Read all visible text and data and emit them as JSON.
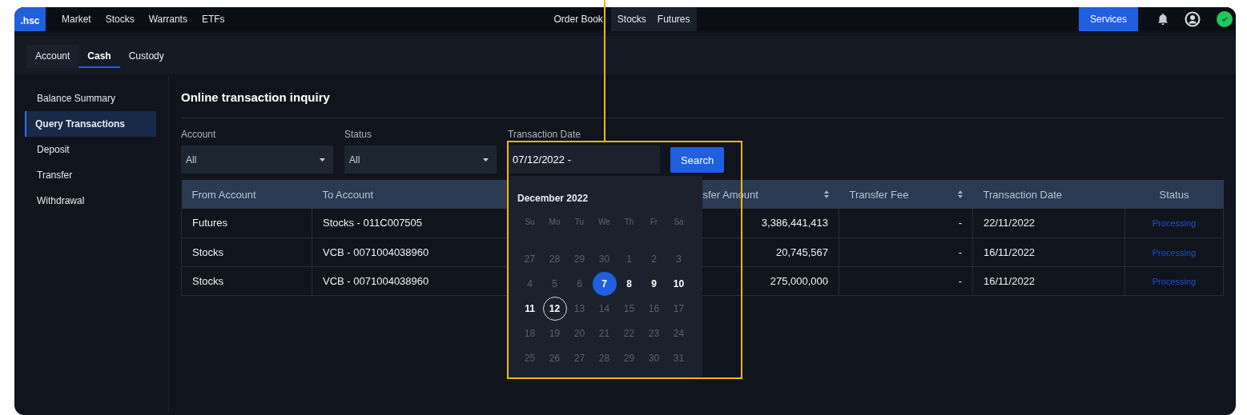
{
  "topbar": {
    "logo": ".hsc",
    "nav": [
      {
        "label": "Market"
      },
      {
        "label": "Stocks"
      },
      {
        "label": "Warrants"
      },
      {
        "label": "ETFs"
      }
    ],
    "order_book": {
      "label": "Order Book",
      "expanded": true,
      "tabs": [
        {
          "label": "Stocks"
        },
        {
          "label": "Futures"
        }
      ]
    },
    "services_button": "Services",
    "connected": true
  },
  "tabs": [
    {
      "label": "Account",
      "selected": false
    },
    {
      "label": "Cash",
      "selected": true
    },
    {
      "label": "Custody",
      "selected": false
    }
  ],
  "sidebar": {
    "items": [
      {
        "label": "Balance Summary",
        "selected": false
      },
      {
        "label": "Query Transactions",
        "selected": true
      },
      {
        "label": "Deposit",
        "selected": false
      },
      {
        "label": "Transfer",
        "selected": false
      },
      {
        "label": "Withdrawal",
        "selected": false
      }
    ]
  },
  "page": {
    "title": "Online transaction inquiry",
    "filters": [
      {
        "kind": "select",
        "label": "Account",
        "value": "All"
      },
      {
        "kind": "select",
        "label": "Status",
        "value": "All"
      },
      {
        "kind": "date",
        "label": "Transaction Date",
        "value": "07/12/2022 -"
      }
    ],
    "search_button": "Search"
  },
  "table": {
    "columns": [
      {
        "label": "From Account",
        "kind": "text",
        "sortable": false
      },
      {
        "label": "To Account",
        "kind": "text"
      },
      {
        "label": "sfer Amount",
        "kind": "number",
        "sortable": true
      },
      {
        "label": "Transfer Fee",
        "kind": "number",
        "sortable": true
      },
      {
        "label": "Transaction Date",
        "kind": "text",
        "sortable": false
      },
      {
        "label": "Status",
        "kind": "status",
        "sortable": false
      }
    ],
    "rows": [
      {
        "cells": [
          "Futures",
          "Stocks - 011C007505",
          "3,386,441,413",
          "-",
          "22/11/2022",
          "Processing"
        ]
      },
      {
        "cells": [
          "Stocks",
          "VCB - 0071004038960",
          "20,745,567",
          "-",
          "16/11/2022",
          "Processing"
        ]
      },
      {
        "cells": [
          "Stocks",
          "VCB - 0071004038960",
          "275,000,000",
          "-",
          "16/11/2022",
          "Processing"
        ]
      }
    ]
  },
  "calendar": {
    "month": "December 2022",
    "weekdays": [
      "Su",
      "Mo",
      "Tu",
      "We",
      "Th",
      "Fr",
      "Sa"
    ],
    "weeks": [
      [
        {
          "day": "27",
          "disabled": true,
          "selected": false,
          "today": false
        },
        {
          "day": "28",
          "disabled": true,
          "selected": false,
          "today": false
        },
        {
          "day": "29",
          "disabled": true,
          "selected": false,
          "today": false
        },
        {
          "day": "30",
          "disabled": true,
          "selected": false,
          "today": false
        },
        {
          "day": "1",
          "disabled": true,
          "selected": false,
          "today": false
        },
        {
          "day": "2",
          "disabled": true,
          "selected": false,
          "today": false
        },
        {
          "day": "3",
          "disabled": true,
          "selected": false,
          "today": false
        }
      ],
      [
        {
          "day": "4",
          "disabled": true,
          "selected": false,
          "today": false
        },
        {
          "day": "5",
          "disabled": true,
          "selected": false,
          "today": false
        },
        {
          "day": "6",
          "disabled": true,
          "selected": false,
          "today": false
        },
        {
          "day": "7",
          "disabled": false,
          "selected": true,
          "today": false
        },
        {
          "day": "8",
          "disabled": false,
          "selected": false,
          "today": false
        },
        {
          "day": "9",
          "disabled": false,
          "selected": false,
          "today": false
        },
        {
          "day": "10",
          "disabled": false,
          "selected": false,
          "today": false
        }
      ],
      [
        {
          "day": "11",
          "disabled": false,
          "selected": false,
          "today": false
        },
        {
          "day": "12",
          "disabled": false,
          "selected": false,
          "today": true
        },
        {
          "day": "13",
          "disabled": true,
          "selected": false,
          "today": false
        },
        {
          "day": "14",
          "disabled": true,
          "selected": false,
          "today": false
        },
        {
          "day": "15",
          "disabled": true,
          "selected": false,
          "today": false
        },
        {
          "day": "16",
          "disabled": true,
          "selected": false,
          "today": false
        },
        {
          "day": "17",
          "disabled": true,
          "selected": false,
          "today": false
        }
      ],
      [
        {
          "day": "18",
          "disabled": true,
          "selected": false,
          "today": false
        },
        {
          "day": "19",
          "disabled": true,
          "selected": false,
          "today": false
        },
        {
          "day": "20",
          "disabled": true,
          "selected": false,
          "today": false
        },
        {
          "day": "21",
          "disabled": true,
          "selected": false,
          "today": false
        },
        {
          "day": "22",
          "disabled": true,
          "selected": false,
          "today": false
        },
        {
          "day": "23",
          "disabled": true,
          "selected": false,
          "today": false
        },
        {
          "day": "24",
          "disabled": true,
          "selected": false,
          "today": false
        }
      ],
      [
        {
          "day": "25",
          "disabled": true,
          "selected": false,
          "today": false
        },
        {
          "day": "26",
          "disabled": true,
          "selected": false,
          "today": false
        },
        {
          "day": "27",
          "disabled": true,
          "selected": false,
          "today": false
        },
        {
          "day": "28",
          "disabled": true,
          "selected": false,
          "today": false
        },
        {
          "day": "29",
          "disabled": true,
          "selected": false,
          "today": false
        },
        {
          "day": "30",
          "disabled": true,
          "selected": false,
          "today": false
        },
        {
          "day": "31",
          "disabled": true,
          "selected": false,
          "today": false
        }
      ]
    ]
  }
}
